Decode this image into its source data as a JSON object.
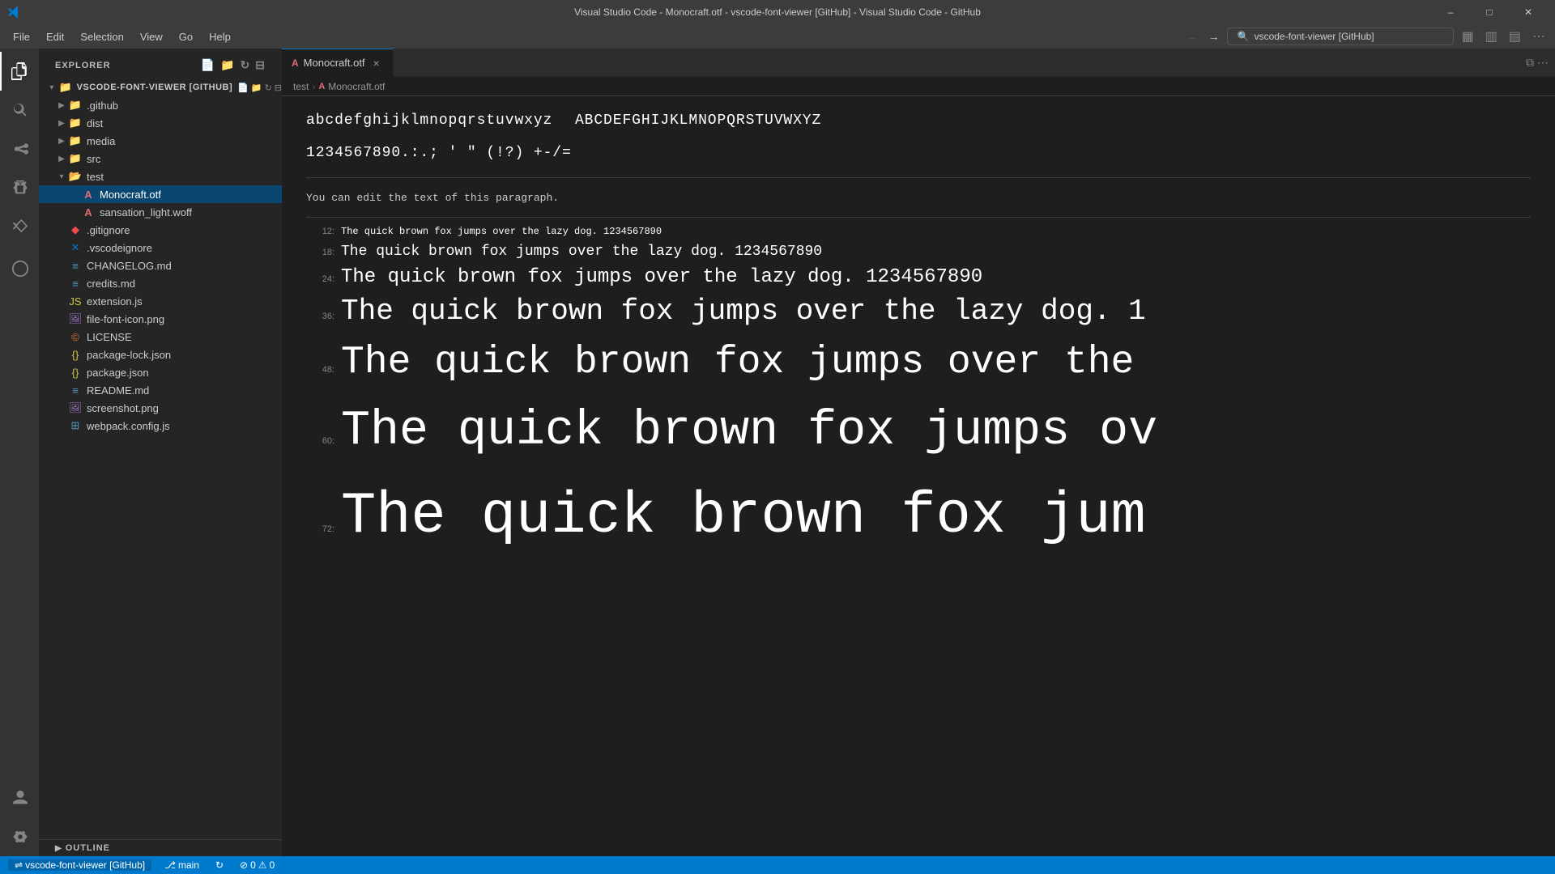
{
  "titlebar": {
    "title": "Visual Studio Code - Monocraft.otf - vscode-font-viewer [GitHub] - Visual Studio Code - GitHub",
    "controls": [
      "minimize",
      "maximize",
      "restore",
      "close"
    ]
  },
  "menubar": {
    "items": [
      "File",
      "Edit",
      "Selection",
      "View",
      "Go",
      "Help"
    ]
  },
  "searchbar": {
    "value": "vscode-font-viewer [GitHub]"
  },
  "nav": {
    "back_label": "←",
    "forward_label": "→"
  },
  "activitybar": {
    "icons": [
      {
        "name": "explorer",
        "symbol": "⧉",
        "active": true
      },
      {
        "name": "search",
        "symbol": "🔍"
      },
      {
        "name": "source-control",
        "symbol": "⎇"
      },
      {
        "name": "debug",
        "symbol": "▷"
      },
      {
        "name": "extensions",
        "symbol": "⊞"
      },
      {
        "name": "remote-explorer",
        "symbol": "⌘"
      },
      {
        "name": "account",
        "symbol": "👤",
        "bottom": true
      },
      {
        "name": "settings",
        "symbol": "⚙",
        "bottom": true
      }
    ]
  },
  "sidebar": {
    "header": "Explorer",
    "header_icons": [
      "new-file",
      "new-folder",
      "refresh",
      "collapse"
    ],
    "root_folder": "VSCODE-FONT-VIEWER [GITHUB]",
    "tree": [
      {
        "label": ".github",
        "type": "folder",
        "depth": 1,
        "icon": "folder"
      },
      {
        "label": "dist",
        "type": "folder",
        "depth": 1,
        "icon": "folder"
      },
      {
        "label": "media",
        "type": "folder",
        "depth": 1,
        "icon": "folder"
      },
      {
        "label": "src",
        "type": "folder",
        "depth": 1,
        "icon": "folder"
      },
      {
        "label": "test",
        "type": "folder",
        "depth": 1,
        "icon": "folder-open",
        "expanded": true
      },
      {
        "label": "Monocraft.otf",
        "type": "file",
        "depth": 2,
        "icon": "font",
        "selected": true
      },
      {
        "label": "sansation_light.woff",
        "type": "file",
        "depth": 2,
        "icon": "woff"
      },
      {
        "label": ".gitignore",
        "type": "file",
        "depth": 1,
        "icon": "gitignore"
      },
      {
        "label": ".vscodeignore",
        "type": "file",
        "depth": 1,
        "icon": "vscodeignore"
      },
      {
        "label": "CHANGELOG.md",
        "type": "file",
        "depth": 1,
        "icon": "md"
      },
      {
        "label": "credits.md",
        "type": "file",
        "depth": 1,
        "icon": "md"
      },
      {
        "label": "extension.js",
        "type": "file",
        "depth": 1,
        "icon": "js"
      },
      {
        "label": "file-font-icon.png",
        "type": "file",
        "depth": 1,
        "icon": "png"
      },
      {
        "label": "LICENSE",
        "type": "file",
        "depth": 1,
        "icon": "license"
      },
      {
        "label": "package-lock.json",
        "type": "file",
        "depth": 1,
        "icon": "json"
      },
      {
        "label": "package.json",
        "type": "file",
        "depth": 1,
        "icon": "json"
      },
      {
        "label": "README.md",
        "type": "file",
        "depth": 1,
        "icon": "md"
      },
      {
        "label": "screenshot.png",
        "type": "file",
        "depth": 1,
        "icon": "png"
      },
      {
        "label": "webpack.config.js",
        "type": "file",
        "depth": 1,
        "icon": "js"
      }
    ],
    "outline": "OUTLINE"
  },
  "tabs": {
    "items": [
      {
        "label": "Monocraft.otf",
        "active": true,
        "icon": "font"
      }
    ],
    "right_icons": [
      "split",
      "more"
    ]
  },
  "breadcrumb": {
    "parts": [
      "test",
      "Monocraft.otf"
    ]
  },
  "font_viewer": {
    "alphabet_upper": "ABCDEFGHIJKLMNOPQRSTUVWXYZ",
    "alphabet_lower": "abcdefghijklmnopqrstuvwxyz",
    "special_chars": "1234567890.:.;  '  \"  (!?)  +-/=",
    "editable_text": "You can edit the text of this paragraph.",
    "preview_rows": [
      {
        "size": 12,
        "label": "12:",
        "text": "The quick brown fox jumps over the lazy dog. 1234567890"
      },
      {
        "size": 18,
        "label": "18:",
        "text": "The quick brown fox jumps over the lazy dog. 1234567890"
      },
      {
        "size": 24,
        "label": "24:",
        "text": "The quick brown fox jumps over the lazy dog. 1234567890"
      },
      {
        "size": 36,
        "label": "36:",
        "text": "The quick brown fox jumps over the lazy dog. 1"
      },
      {
        "size": 48,
        "label": "48:",
        "text": "The quick brown fox jumps over the"
      },
      {
        "size": 60,
        "label": "60:",
        "text": "The quick brown fox jumps ov"
      },
      {
        "size": 72,
        "label": "72:",
        "text": "The quick brown fox jum"
      }
    ]
  },
  "statusbar": {
    "branch": "main",
    "errors": "0",
    "warnings": "0",
    "left_items": [
      "sync",
      "main",
      "errors-warnings"
    ],
    "right_items": []
  }
}
